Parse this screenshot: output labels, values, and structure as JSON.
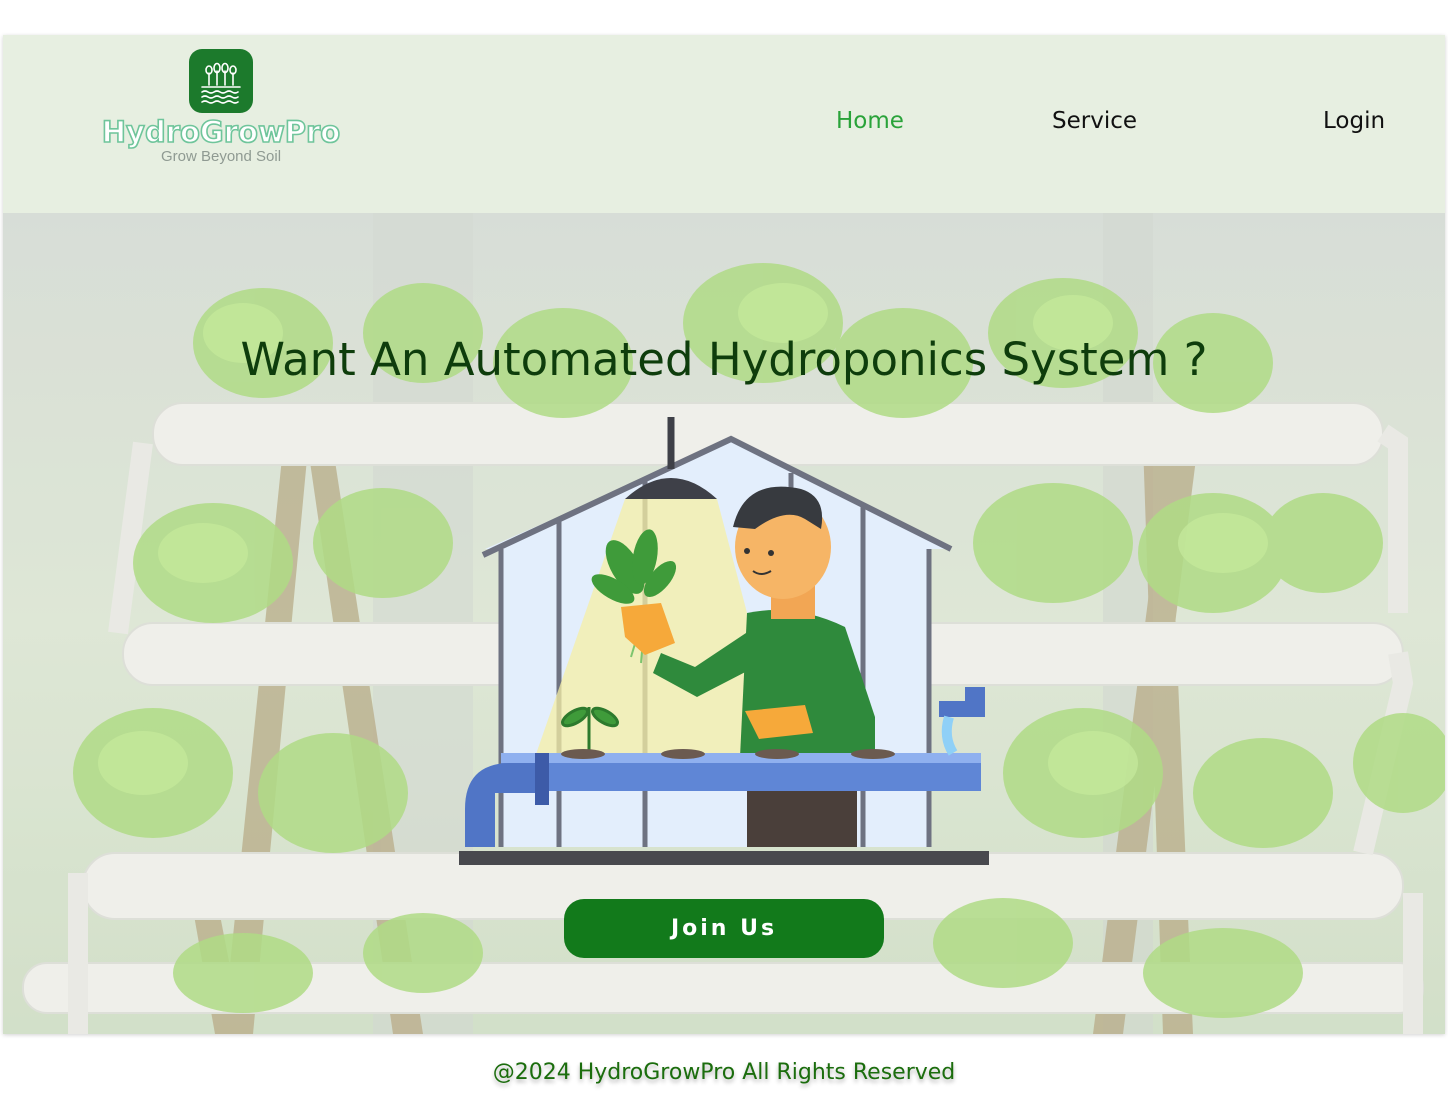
{
  "brand": {
    "name": "HydroGrowPro",
    "tagline": "Grow Beyond Soil",
    "logo_icon": "hydroponic-plants-icon",
    "primary_color": "#127a1b",
    "accent_color": "#2aa33a"
  },
  "nav": {
    "items": [
      {
        "label": "Home",
        "active": true
      },
      {
        "label": "Service",
        "active": false
      },
      {
        "label": "Login",
        "active": false
      }
    ]
  },
  "hero": {
    "title": "Want An Automated Hydroponics System ?",
    "cta_label": "Join Us",
    "background": "hydroponic-lettuce-photo",
    "illustration": "greenhouse-farmer-illustration"
  },
  "footer": {
    "text": "@2024 HydroGrowPro All Rights Reserved"
  }
}
